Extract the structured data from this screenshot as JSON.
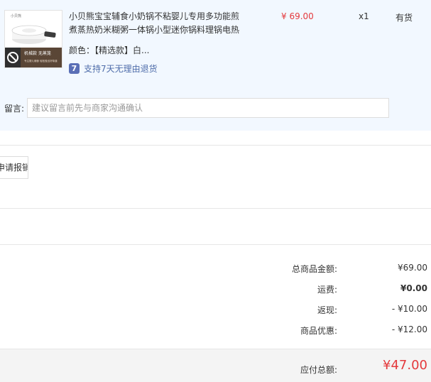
{
  "product": {
    "title": "小贝熊宝宝辅食小奶锅不粘婴儿专用多功能煎煮蒸热奶米糊粥一体锅小型迷你锅料理锅电热",
    "unit_price": "¥ 69.00",
    "quantity": "x1",
    "stock_status": "有货",
    "spec": "颜色：【精选款】白...",
    "return_icon_glyph": "7",
    "return_policy": "支持7天无理由退货",
    "thumbnail": {
      "brand_mark": "小贝熊",
      "banner_text": "机械款 无蒸笼",
      "sub_text": "专注婴儿辅食 轻松做出好味道"
    }
  },
  "note": {
    "label": "留言:",
    "placeholder": "建议留言前先与商家沟通确认"
  },
  "invoice": {
    "button_label": "申请报销"
  },
  "summary": {
    "rows": [
      {
        "label": "总商品金额:",
        "value": "¥69.00"
      },
      {
        "label": "运费:",
        "value": "¥0.00"
      },
      {
        "label": "返现:",
        "value": "- ¥10.00"
      },
      {
        "label": "商品优惠:",
        "value": "- ¥12.00"
      }
    ],
    "total_label": "应付总额:",
    "total_value": "¥47.00"
  },
  "colors": {
    "price_red": "#e4393c",
    "link_blue": "#4f6daa",
    "product_bg": "#f2f8ff"
  }
}
